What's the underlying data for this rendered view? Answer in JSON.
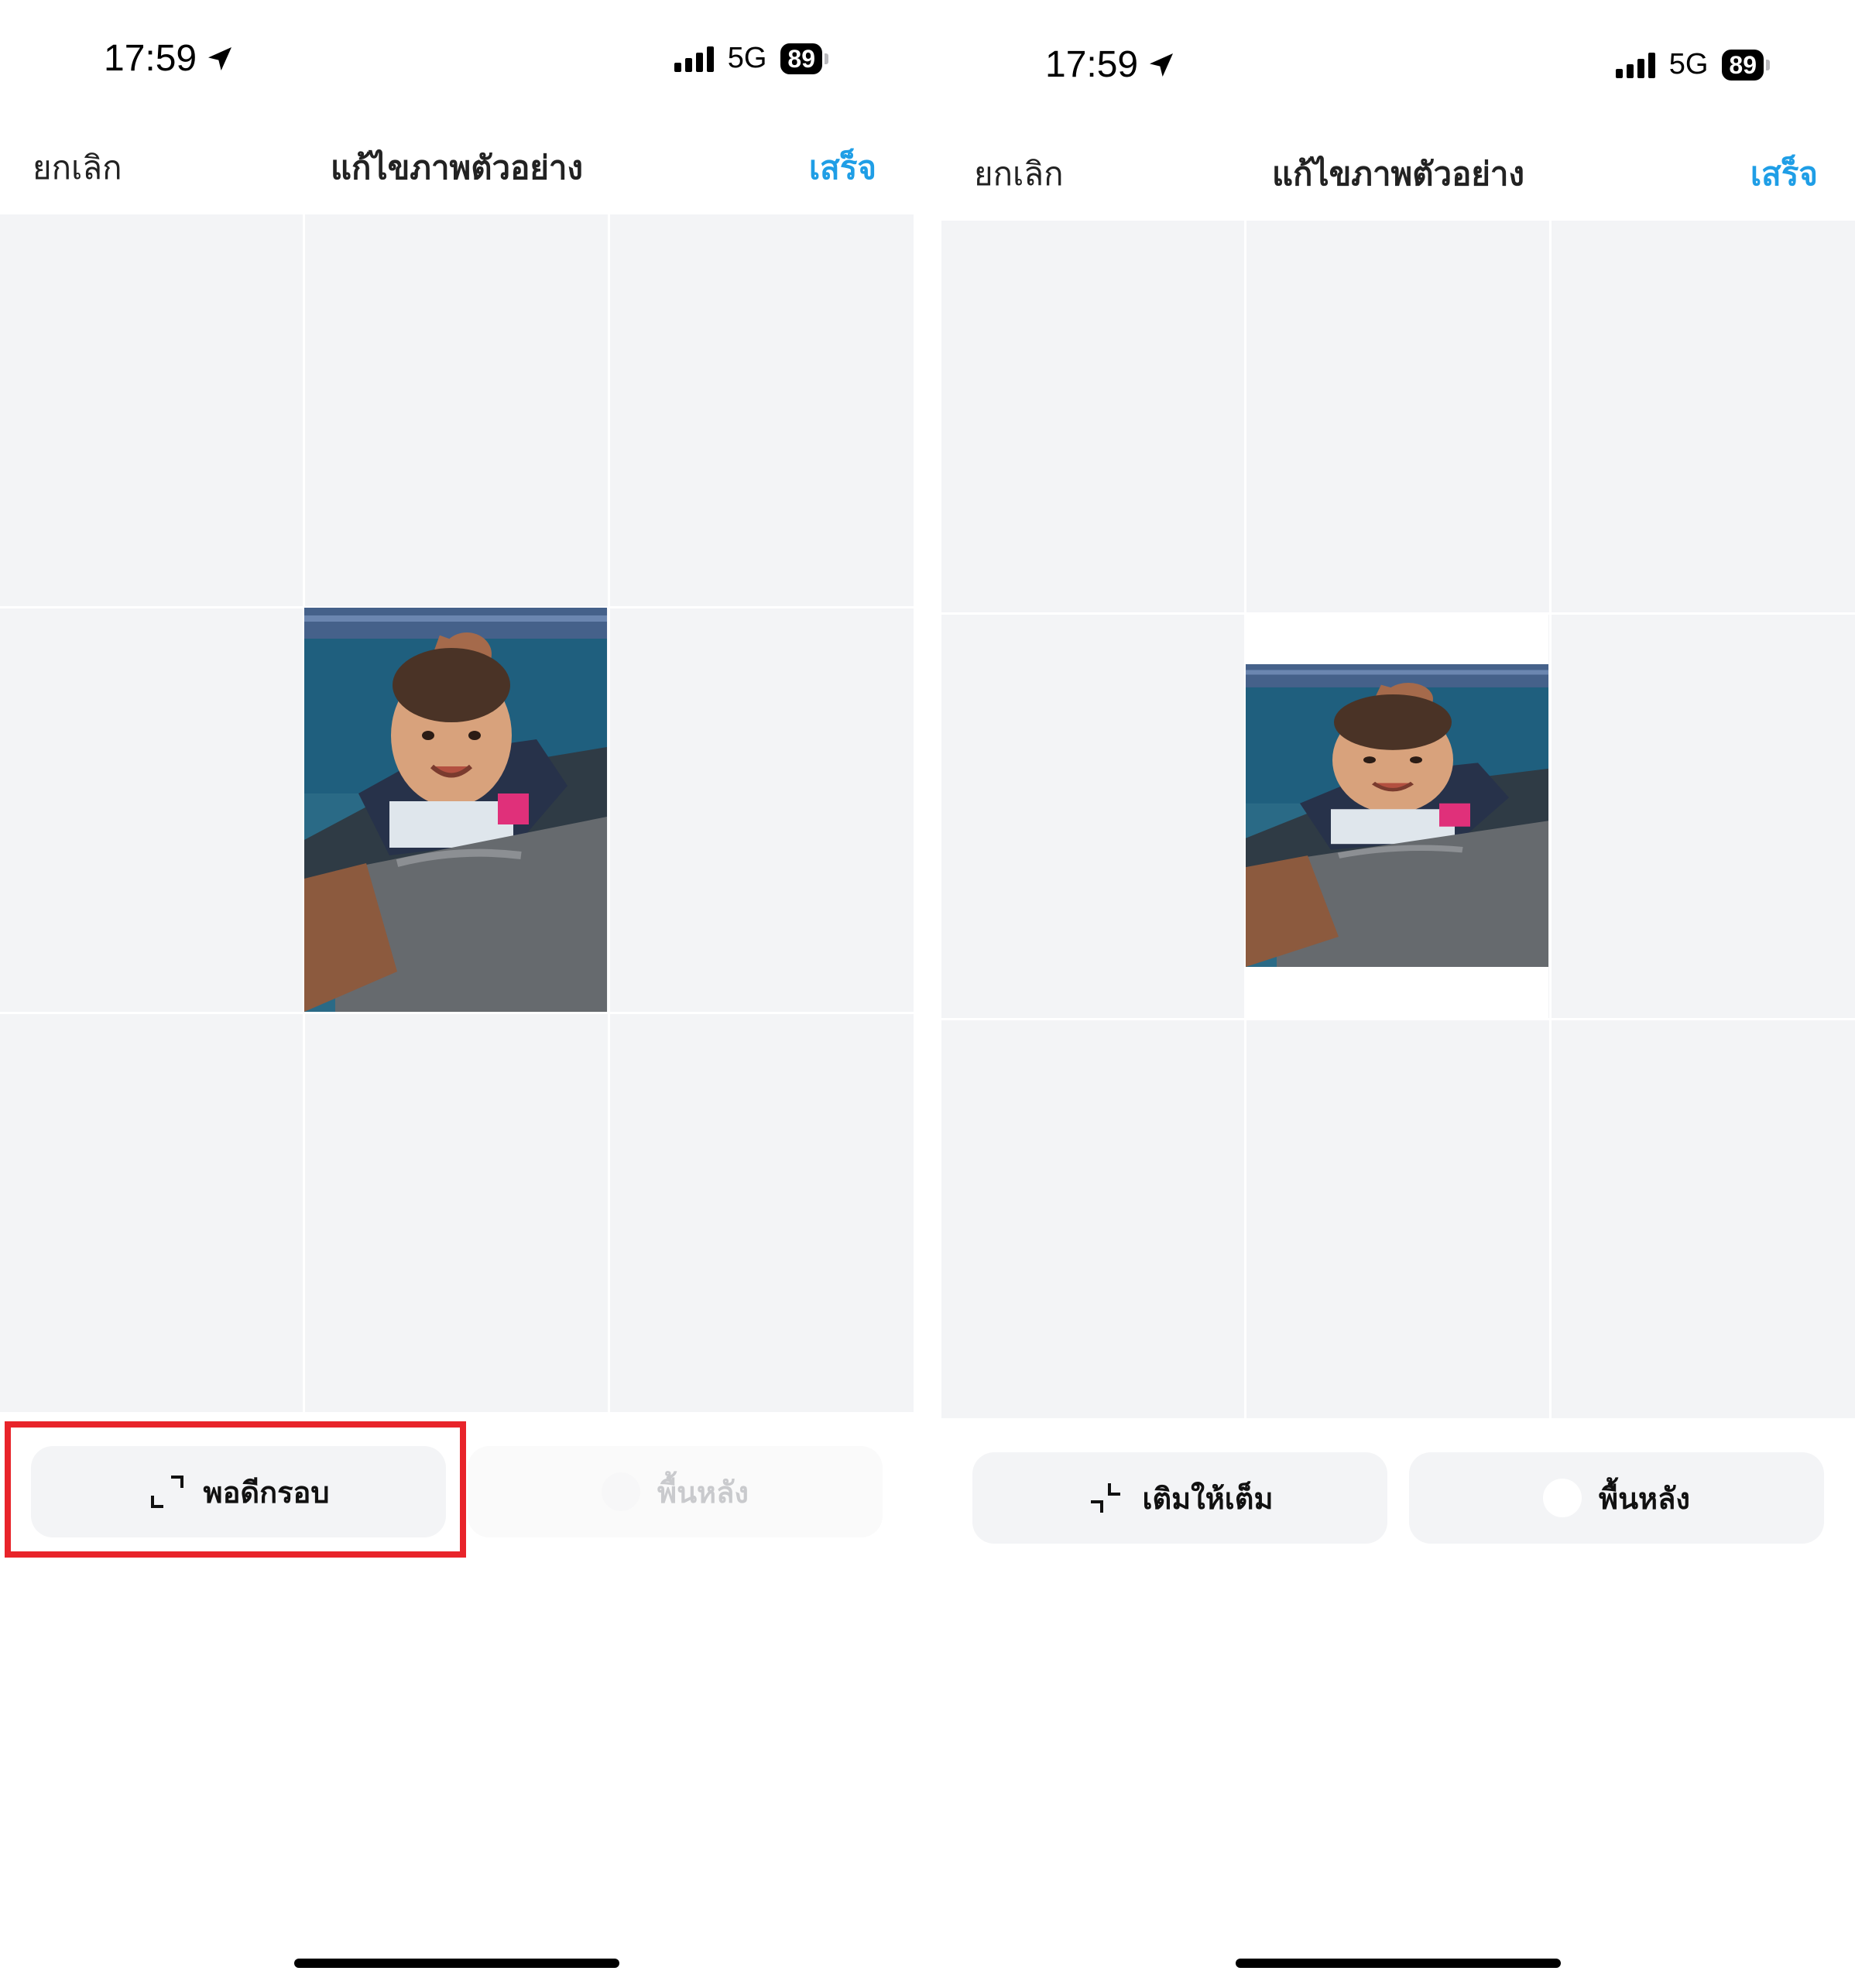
{
  "screens": [
    {
      "status": {
        "time": "17:59",
        "network": "5G",
        "battery": "89"
      },
      "nav": {
        "cancel": "ยกเลิก",
        "title": "แก้ไขภาพตัวอย่าง",
        "done": "เสร็จ"
      },
      "toolbar": {
        "mode_label": "พอดีกรอบ",
        "background_label": "พื้นหลัง"
      }
    },
    {
      "status": {
        "time": "17:59",
        "network": "5G",
        "battery": "89"
      },
      "nav": {
        "cancel": "ยกเลิก",
        "title": "แก้ไขภาพตัวอย่าง",
        "done": "เสร็จ"
      },
      "toolbar": {
        "mode_label": "เติมให้เต็ม",
        "background_label": "พื้นหลัง"
      }
    }
  ],
  "colors": {
    "accent": "#1f9ee6",
    "highlight": "#e8242a",
    "grid_bg": "#f3f4f6"
  }
}
